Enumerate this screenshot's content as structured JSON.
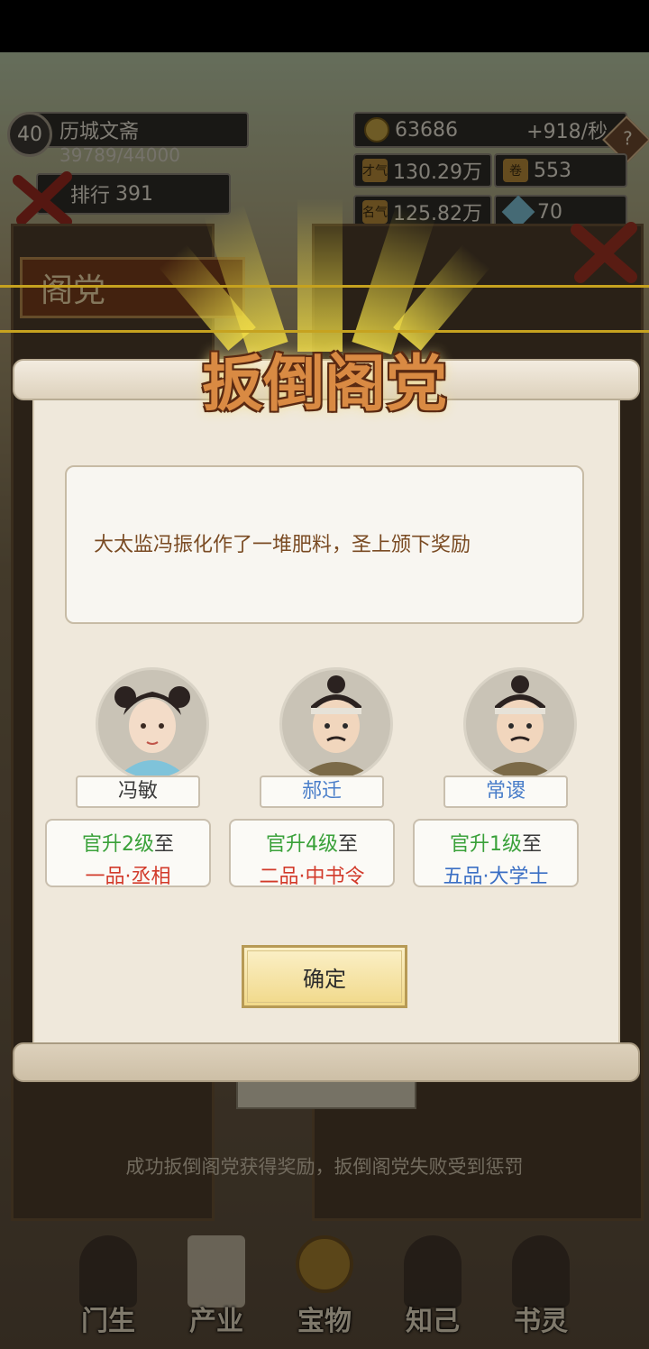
{
  "header": {
    "level": "40",
    "location": "历城文斋",
    "exp": "39789/44000",
    "rank_label": "排行",
    "rank_value": "391",
    "coins": "63686",
    "coin_rate": "+918/秒",
    "talent_label": "才气",
    "talent_value": "130.29万",
    "fame_label": "名气",
    "fame_value": "125.82万",
    "scroll_count": "553",
    "gem_count": "70"
  },
  "background": {
    "tab_label": "阁党",
    "hint": "成功扳倒阁党获得奖励，扳倒阁党失败受到惩罚"
  },
  "dialog": {
    "title": "扳倒阁党",
    "message": "大太监冯振化作了一堆肥料，圣上颁下奖励",
    "confirm_label": "确定",
    "rewards": [
      {
        "name": "冯敏",
        "name_color": "#3a3a3a",
        "promo_prefix": "官升",
        "promo_level": "2级",
        "promo_suffix": "至",
        "rank": "一品·丞相",
        "rank_color": "#d23a2a"
      },
      {
        "name": "郝迁",
        "name_color": "#4a7ec9",
        "promo_prefix": "官升",
        "promo_level": "4级",
        "promo_suffix": "至",
        "rank": "二品·中书令",
        "rank_color": "#d23a2a"
      },
      {
        "name": "常谡",
        "name_color": "#4a7ec9",
        "promo_prefix": "官升",
        "promo_level": "1级",
        "promo_suffix": "至",
        "rank": "五品·大学士",
        "rank_color": "#3b6fc4"
      }
    ]
  },
  "nav": [
    {
      "label": "门生"
    },
    {
      "label": "产业"
    },
    {
      "label": "宝物"
    },
    {
      "label": "知己"
    },
    {
      "label": "书灵"
    }
  ]
}
